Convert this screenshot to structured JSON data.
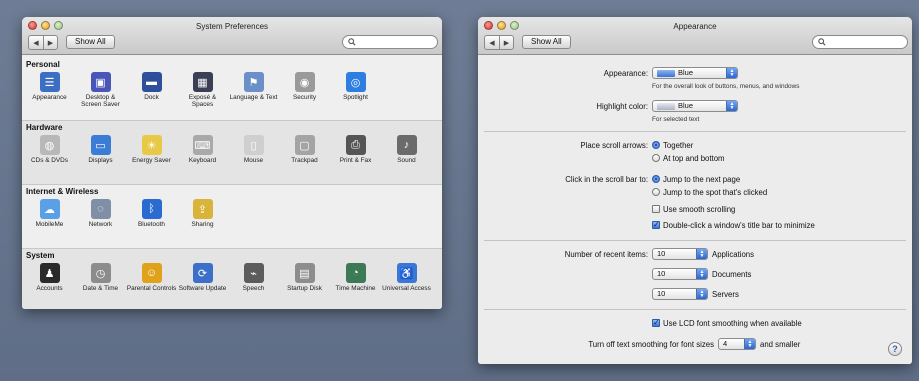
{
  "left_window": {
    "title": "System Preferences",
    "show_all": "Show All",
    "sections": [
      {
        "title": "Personal",
        "panes": [
          {
            "label": "Appearance",
            "icon": "appearance-icon",
            "glyph": "☰",
            "color": "#3c6fc4"
          },
          {
            "label": "Desktop & Screen Saver",
            "icon": "desktop-icon",
            "glyph": "▣",
            "color": "#4a55b8"
          },
          {
            "label": "Dock",
            "icon": "dock-icon",
            "glyph": "▬",
            "color": "#2d4f9c"
          },
          {
            "label": "Exposé & Spaces",
            "icon": "expose-icon",
            "glyph": "▦",
            "color": "#3a3f55"
          },
          {
            "label": "Language & Text",
            "icon": "language-icon",
            "glyph": "⚑",
            "color": "#6b8fc8"
          },
          {
            "label": "Security",
            "icon": "security-icon",
            "glyph": "◉",
            "color": "#9a9a9a"
          },
          {
            "label": "Spotlight",
            "icon": "spotlight-icon",
            "glyph": "◎",
            "color": "#2e7de0"
          }
        ]
      },
      {
        "title": "Hardware",
        "panes": [
          {
            "label": "CDs & DVDs",
            "icon": "cd-icon",
            "glyph": "◍",
            "color": "#b8b8b8"
          },
          {
            "label": "Displays",
            "icon": "displays-icon",
            "glyph": "▭",
            "color": "#3b7cd4"
          },
          {
            "label": "Energy Saver",
            "icon": "energy-icon",
            "glyph": "☀",
            "color": "#e8c947"
          },
          {
            "label": "Keyboard",
            "icon": "keyboard-icon",
            "glyph": "⌨",
            "color": "#a9a9a9"
          },
          {
            "label": "Mouse",
            "icon": "mouse-icon",
            "glyph": "▯",
            "color": "#cfcfcf"
          },
          {
            "label": "Trackpad",
            "icon": "trackpad-icon",
            "glyph": "▢",
            "color": "#a4a4a4"
          },
          {
            "label": "Print & Fax",
            "icon": "printer-icon",
            "glyph": "⎙",
            "color": "#555555"
          },
          {
            "label": "Sound",
            "icon": "sound-icon",
            "glyph": "♪",
            "color": "#6b6b6b"
          }
        ]
      },
      {
        "title": "Internet & Wireless",
        "panes": [
          {
            "label": "MobileMe",
            "icon": "mobileme-icon",
            "glyph": "☁",
            "color": "#5aa0e6"
          },
          {
            "label": "Network",
            "icon": "network-icon",
            "glyph": "◌",
            "color": "#7f8fa6"
          },
          {
            "label": "Bluetooth",
            "icon": "bluetooth-icon",
            "glyph": "ᛒ",
            "color": "#2a6bd1"
          },
          {
            "label": "Sharing",
            "icon": "sharing-icon",
            "glyph": "⇪",
            "color": "#d9b43a"
          }
        ]
      },
      {
        "title": "System",
        "panes": [
          {
            "label": "Accounts",
            "icon": "accounts-icon",
            "glyph": "♟",
            "color": "#2a2a2a"
          },
          {
            "label": "Date & Time",
            "icon": "clock-icon",
            "glyph": "◷",
            "color": "#8c8c8c"
          },
          {
            "label": "Parental Controls",
            "icon": "parental-icon",
            "glyph": "☺",
            "color": "#e0a21a"
          },
          {
            "label": "Software Update",
            "icon": "update-icon",
            "glyph": "⟳",
            "color": "#3b6fc9"
          },
          {
            "label": "Speech",
            "icon": "speech-icon",
            "glyph": "⌁",
            "color": "#5c5c5c"
          },
          {
            "label": "Startup Disk",
            "icon": "disk-icon",
            "glyph": "▤",
            "color": "#8d8d8d"
          },
          {
            "label": "Time Machine",
            "icon": "timemachine-icon",
            "glyph": "◔",
            "color": "#3c7a55"
          },
          {
            "label": "Universal Access",
            "icon": "accessibility-icon",
            "glyph": "♿",
            "color": "#3a78d6"
          }
        ]
      }
    ]
  },
  "right_window": {
    "title": "Appearance",
    "show_all": "Show All",
    "appearance_label": "Appearance:",
    "appearance_value": "Blue",
    "appearance_note": "For the overall look of buttons, menus, and windows",
    "highlight_label": "Highlight color:",
    "highlight_value": "Blue",
    "highlight_note": "For selected text",
    "scroll_arrows_label": "Place scroll arrows:",
    "scroll_arrows_options": [
      "Together",
      "At top and bottom"
    ],
    "scroll_arrows_selected": 0,
    "click_scroll_label": "Click in the scroll bar to:",
    "click_scroll_options": [
      "Jump to the next page",
      "Jump to the spot that's clicked"
    ],
    "click_scroll_selected": 0,
    "smooth_scrolling": "Use smooth scrolling",
    "smooth_scrolling_checked": false,
    "double_click": "Double-click a window's title bar to minimize",
    "double_click_checked": true,
    "recent_label": "Number of recent items:",
    "recent_items": [
      {
        "value": "10",
        "label": "Applications"
      },
      {
        "value": "10",
        "label": "Documents"
      },
      {
        "value": "10",
        "label": "Servers"
      }
    ],
    "lcd_smoothing": "Use LCD font smoothing when available",
    "lcd_smoothing_checked": true,
    "smoothing_off_label": "Turn off text smoothing for font sizes",
    "smoothing_off_value": "4",
    "smoothing_off_suffix": "and smaller",
    "help": "?"
  }
}
